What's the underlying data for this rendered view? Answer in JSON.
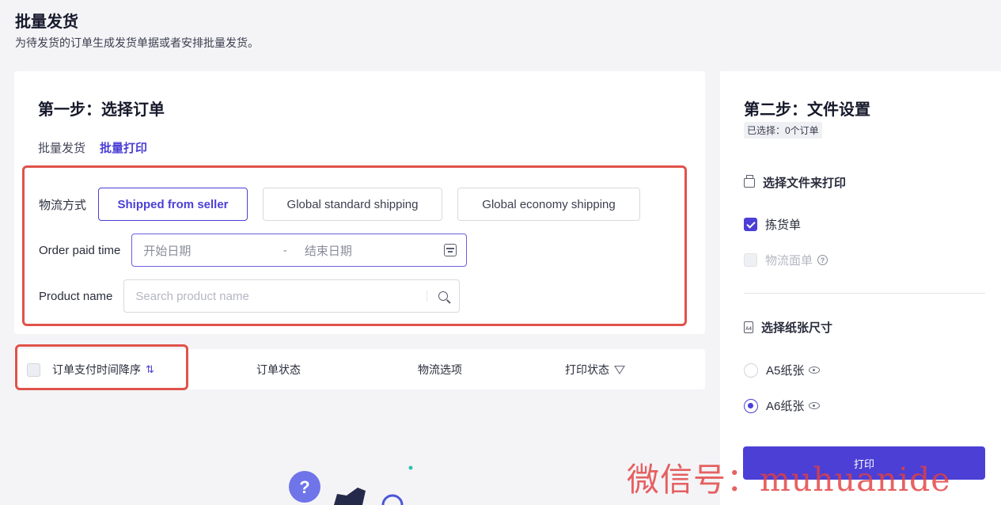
{
  "page": {
    "title": "批量发货",
    "subtitle": "为待发货的订单生成发货单据或者安排批量发货。"
  },
  "step1": {
    "title": "第一步：选择订单",
    "tabs": [
      {
        "label": "批量发货",
        "active": false
      },
      {
        "label": "批量打印",
        "active": true
      }
    ],
    "filters": {
      "shipping_label": "物流方式",
      "shipping_options": [
        {
          "label": "Shipped from seller",
          "selected": true
        },
        {
          "label": "Global standard shipping",
          "selected": false
        },
        {
          "label": "Global economy shipping",
          "selected": false
        }
      ],
      "paid_time_label": "Order paid time",
      "start_placeholder": "开始日期",
      "range_sep": "-",
      "end_placeholder": "结束日期",
      "product_label": "Product name",
      "product_placeholder": "Search product name"
    },
    "table": {
      "col_paid_time": "订单支付时间降序",
      "col_status": "订单状态",
      "col_logistics": "物流选项",
      "col_print_status": "打印状态"
    }
  },
  "step2": {
    "title": "第二步：文件设置",
    "selected_count": "已选择：0个订单",
    "file_section": "选择文件来打印",
    "files": [
      {
        "label": "拣货单",
        "checked": true,
        "disabled": false
      },
      {
        "label": "物流面单",
        "checked": false,
        "disabled": true
      }
    ],
    "paper_section": "选择纸张尺寸",
    "papers": [
      {
        "label": "A5纸张",
        "selected": false
      },
      {
        "label": "A6纸张",
        "selected": true
      }
    ],
    "print_button": "打印"
  },
  "watermark": "微信号：muhuanide",
  "colors": {
    "accent": "#4b3fd6",
    "highlight_border": "#e0524a",
    "background": "#f4f4f7"
  }
}
